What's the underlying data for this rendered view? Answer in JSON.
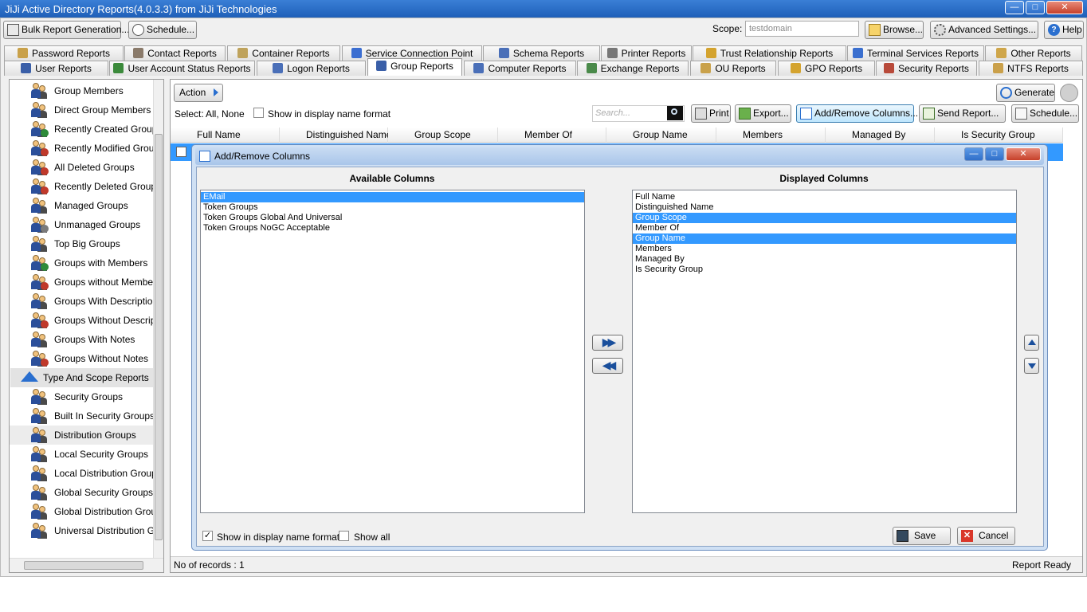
{
  "window": {
    "title": "JiJi Active Directory Reports(4.0.3.3) from JiJi Technologies"
  },
  "toolbar": {
    "bulk_report": "Bulk Report Generation...",
    "schedule": "Schedule...",
    "scope_label": "Scope:",
    "scope_value": "testdomain",
    "browse": "Browse...",
    "advanced_settings": "Advanced Settings...",
    "help": "Help"
  },
  "tabs_row1": [
    "Password Reports",
    "Contact Reports",
    "Container Reports",
    "Service Connection Point",
    "Schema Reports",
    "Printer Reports",
    "Trust Relationship Reports",
    "Terminal Services Reports",
    "Other Reports"
  ],
  "tabs_row2": [
    "User Reports",
    "User Account Status Reports",
    "Logon Reports",
    "Group Reports",
    "Computer Reports",
    "Exchange Reports",
    "OU Reports",
    "GPO Reports",
    "Security Reports",
    "NTFS Reports"
  ],
  "sidebar": {
    "items": [
      {
        "label": "Group Members"
      },
      {
        "label": "Direct Group Members"
      },
      {
        "label": "Recently Created Groups"
      },
      {
        "label": "Recently Modified Groups"
      },
      {
        "label": "All Deleted Groups"
      },
      {
        "label": "Recently Deleted Groups"
      },
      {
        "label": "Managed Groups"
      },
      {
        "label": "Unmanaged Groups"
      },
      {
        "label": "Top Big Groups"
      },
      {
        "label": "Groups with Members"
      },
      {
        "label": "Groups without Members"
      },
      {
        "label": "Groups With Description"
      },
      {
        "label": "Groups Without Descriptic"
      },
      {
        "label": "Groups With Notes"
      },
      {
        "label": "Groups Without Notes"
      }
    ],
    "section": "Type And Scope Reports",
    "section_items": [
      {
        "label": "Security Groups"
      },
      {
        "label": "Built In Security Groups"
      },
      {
        "label": "Distribution Groups"
      },
      {
        "label": "Local Security Groups"
      },
      {
        "label": "Local Distribution Groups"
      },
      {
        "label": "Global Security Groups"
      },
      {
        "label": "Global Distribution Groups"
      },
      {
        "label": "Universal Distribution Grou"
      }
    ]
  },
  "main": {
    "action": "Action",
    "generate": "Generate",
    "select_label": "Select:",
    "select_all": "All,",
    "select_none": "None",
    "show_display_name": "Show in display name format",
    "search_placeholder": "Search...",
    "print": "Print",
    "export": "Export...",
    "add_remove_columns": "Add/Remove Columns...",
    "send_report": "Send Report...",
    "schedule": "Schedule...",
    "columns": [
      "Full Name",
      "Distinguished Name",
      "Group Scope",
      "Member Of",
      "Group Name",
      "Members",
      "Managed By",
      "Is Security Group"
    ]
  },
  "dialog": {
    "title": "Add/Remove Columns",
    "available_heading": "Available Columns",
    "displayed_heading": "Displayed Columns",
    "available": [
      {
        "label": "EMail",
        "selected": true
      },
      {
        "label": "Token Groups",
        "selected": false
      },
      {
        "label": "Token Groups Global And Universal",
        "selected": false
      },
      {
        "label": "Token Groups NoGC Acceptable",
        "selected": false
      }
    ],
    "displayed": [
      {
        "label": "Full Name",
        "selected": false
      },
      {
        "label": "Distinguished Name",
        "selected": false
      },
      {
        "label": "Group Scope",
        "selected": true
      },
      {
        "label": "Member Of",
        "selected": false
      },
      {
        "label": "Group Name",
        "selected": true
      },
      {
        "label": "Members",
        "selected": false
      },
      {
        "label": "Managed By",
        "selected": false
      },
      {
        "label": "Is Security Group",
        "selected": false
      }
    ],
    "show_display_name": "Show in display name format",
    "show_all": "Show all",
    "save": "Save",
    "cancel": "Cancel"
  },
  "status": {
    "records": "No of records : 1",
    "state": "Report Ready"
  }
}
